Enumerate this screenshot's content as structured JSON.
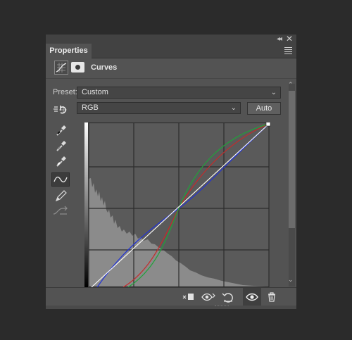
{
  "panel": {
    "tab_label": "Properties",
    "collapse_glyph": "◂◂",
    "close_glyph": "✕"
  },
  "header": {
    "adjustment_icon": "curves-adjustment-icon",
    "mask_icon": "layer-mask-icon",
    "title": "Curves"
  },
  "preset": {
    "label": "Preset:",
    "value": "Custom"
  },
  "channel": {
    "value": "RGB",
    "auto_label": "Auto"
  },
  "tools": [
    "on-image-adjust-icon",
    "black-point-eyedropper-icon",
    "gray-point-eyedropper-icon",
    "white-point-eyedropper-icon",
    "curve-edit-icon",
    "pencil-draw-icon",
    "smooth-curve-icon"
  ],
  "colors": {
    "panel_bg": "#535353",
    "graph_bg": "#5a5a5a",
    "red_curve": "#c62a2a",
    "green_curve": "#1fa33a",
    "blue_curve": "#2233d6",
    "composite_line": "#ffffff",
    "histogram": "#8b8b8b"
  },
  "footer": {
    "buttons": [
      "clip-to-layer-icon",
      "view-previous-state-icon",
      "reset-icon",
      "toggle-visibility-icon",
      "delete-icon"
    ]
  }
}
